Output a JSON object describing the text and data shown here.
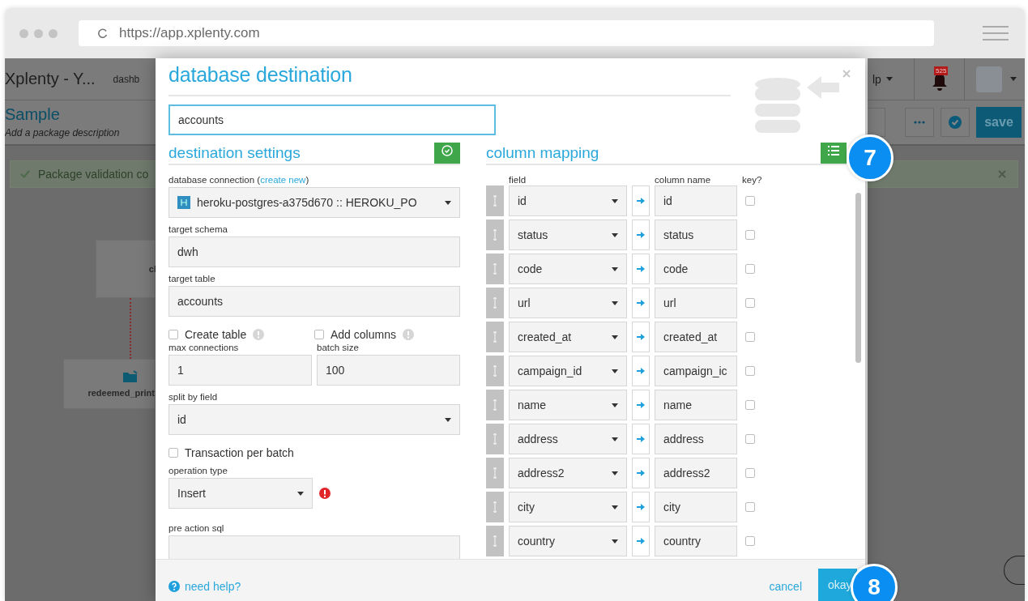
{
  "browser": {
    "url": "https://app.xplenty.com"
  },
  "app": {
    "title": "Xplenty - Y...",
    "nav_item": "dashb",
    "help_menu": "lp",
    "notifications": "525",
    "package_name": "Sample",
    "package_description": "Add a package description",
    "validation_message": "Package validation co",
    "save": "save",
    "canvas_nodes": [
      {
        "label": "cl",
        "kind": "plain"
      },
      {
        "label": "redeemed_print",
        "kind": "source"
      }
    ]
  },
  "modal": {
    "title": "database destination",
    "name_value": "accounts",
    "settings": {
      "heading": "destination settings",
      "items": [
        {
          "kind": "connection",
          "label": "database connection (",
          "link": "create new",
          "label_end": ")",
          "value": "heroku-postgres-a375d670 :: HEROKU_PO"
        },
        {
          "kind": "text",
          "label": "target schema",
          "value": "dwh"
        },
        {
          "kind": "text",
          "label": "target table",
          "value": "accounts"
        },
        {
          "kind": "checks",
          "options": [
            {
              "label": "Create table",
              "checked": false,
              "info": true
            },
            {
              "label": "Add columns",
              "checked": false,
              "info": true
            }
          ]
        },
        {
          "kind": "pair",
          "fields": [
            {
              "label": "max connections",
              "value": "1"
            },
            {
              "label": "batch size",
              "value": "100"
            }
          ]
        },
        {
          "kind": "select",
          "label": "split by field",
          "value": "id",
          "error": false
        },
        {
          "kind": "checks",
          "options": [
            {
              "label": "Transaction per batch",
              "checked": false,
              "info": false
            }
          ]
        },
        {
          "kind": "select",
          "label": "operation type",
          "value": "Insert",
          "error": true
        },
        {
          "kind": "textarea",
          "label": "pre action sql"
        }
      ]
    },
    "mapping": {
      "heading": "column mapping",
      "headers": [
        "field",
        "column name",
        "key?"
      ],
      "rows": [
        {
          "field": "id",
          "column": "id",
          "key": false
        },
        {
          "field": "status",
          "column": "status",
          "key": false
        },
        {
          "field": "code",
          "column": "code",
          "key": false
        },
        {
          "field": "url",
          "column": "url",
          "key": false
        },
        {
          "field": "created_at",
          "column": "created_at",
          "key": false
        },
        {
          "field": "campaign_id",
          "column": "campaign_ic",
          "key": false
        },
        {
          "field": "name",
          "column": "name",
          "key": false
        },
        {
          "field": "address",
          "column": "address",
          "key": false
        },
        {
          "field": "address2",
          "column": "address2",
          "key": false
        },
        {
          "field": "city",
          "column": "city",
          "key": false
        },
        {
          "field": "country",
          "column": "country",
          "key": false
        }
      ]
    },
    "footer": {
      "help": "need help?",
      "cancel": "cancel",
      "okay": "okay"
    }
  },
  "callouts": [
    "7",
    "8"
  ]
}
